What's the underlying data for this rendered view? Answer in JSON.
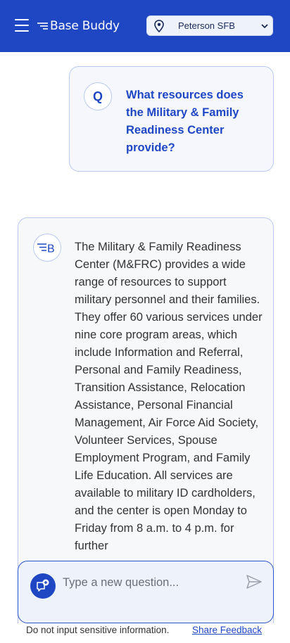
{
  "header": {
    "menu_icon": "hamburger-menu-icon",
    "logo_text": "Base Buddy",
    "logo_icon": "speed-lines-logo-icon",
    "base_select": {
      "value": "Peterson SFB",
      "icon": "location-pin-icon"
    }
  },
  "question": {
    "avatar_letter": "Q",
    "text": "What resources does the Military & Family Readiness Center provide?"
  },
  "answer": {
    "avatar_icon": "base-buddy-b-icon",
    "avatar_letter": "B",
    "text": "The Military & Family Readiness Center (M&FRC) provides a wide range of resources to support military personnel and their families. They offer 60 various services under nine core program areas, which include Information and Referral, Personal and Family Readiness, Transition Assistance, Relocation Assistance, Personal Financial Management, Air Force Aid Society, Volunteer Services, Spouse Employment Program, and Family Life Education. All services are available to military ID cardholders, and the center is open Monday to Friday from 8 a.m. to 4 p.m. for further"
  },
  "input": {
    "placeholder": "Type a new question...",
    "value": "",
    "chat_icon": "new-chat-icon",
    "send_icon": "send-icon"
  },
  "footer": {
    "note": "Do not input sensitive information.",
    "link": "Share Feedback"
  },
  "colors": {
    "brand": "#1f47c4",
    "card_border": "#b9c9ee",
    "question_bg": "#f5f7fd",
    "answer_bg": "#f7f8fa"
  }
}
